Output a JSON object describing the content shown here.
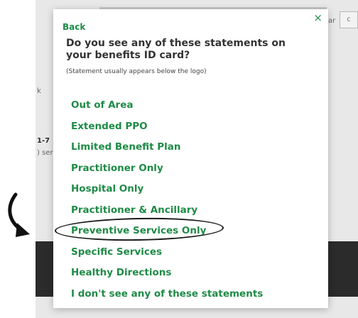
{
  "background": {
    "top_left_fragment": "k",
    "side_number_fragment": "1-7",
    "side_text_fragment": ") ser",
    "top_right_text_fragment": "ar",
    "top_right_button_fragment": "c"
  },
  "modal": {
    "close_glyph": "×",
    "back_label": "Back",
    "question": "Do you see any of these statements on your benefits ID card?",
    "hint": "(Statement usually appears below the logo)",
    "options": [
      "Out of Area",
      "Extended PPO",
      "Limited Benefit Plan",
      "Practitioner Only",
      "Hospital Only",
      "Practitioner & Ancillary",
      "Preventive Services Only",
      "Specific Services",
      "Healthy Directions",
      "I don't see any of these statements"
    ]
  },
  "colors": {
    "accent_green": "#1e8b46",
    "text_dark": "#333333",
    "overlay_dark": "#2b2b2b"
  }
}
